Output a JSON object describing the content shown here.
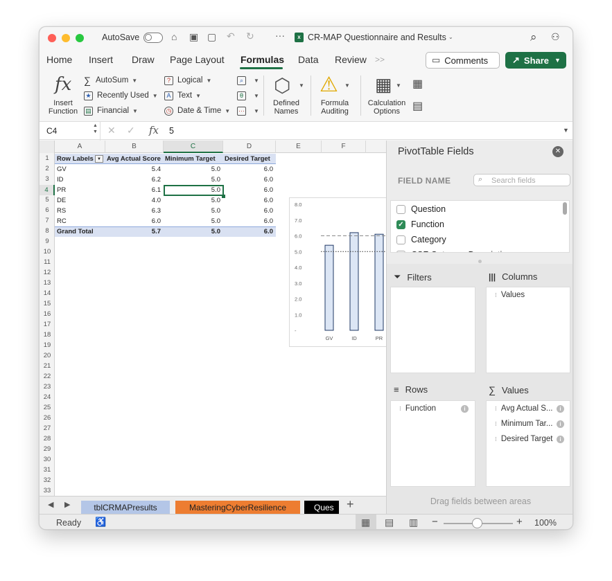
{
  "titlebar": {
    "autosave_label": "AutoSave",
    "title": "CR-MAP Questionnaire and Results"
  },
  "tabs": [
    "Home",
    "Insert",
    "Draw",
    "Page Layout",
    "Formulas",
    "Data",
    "Review"
  ],
  "active_tab": "Formulas",
  "comments_label": "Comments",
  "share_label": "Share",
  "ribbon": {
    "insert_function": "Insert Function",
    "autosum": "AutoSum",
    "recently_used": "Recently Used",
    "financial": "Financial",
    "logical": "Logical",
    "text": "Text",
    "date_time": "Date & Time",
    "defined_names": "Defined Names",
    "formula_auditing": "Formula Auditing",
    "calc_options": "Calculation Options"
  },
  "formula_bar": {
    "cell_ref": "C4",
    "fx": "fx",
    "value": "5"
  },
  "columns": [
    "A",
    "B",
    "C",
    "D",
    "E",
    "F"
  ],
  "rows": [
    "1",
    "2",
    "3",
    "4",
    "5",
    "6",
    "7",
    "8",
    "9",
    "10",
    "11",
    "12",
    "13",
    "14",
    "15",
    "16",
    "17",
    "18",
    "19",
    "20",
    "21",
    "22",
    "23",
    "24",
    "25",
    "26",
    "27",
    "28",
    "29",
    "30",
    "31",
    "32",
    "33"
  ],
  "pivot": {
    "headers": [
      "Row Labels",
      "Avg Actual Score",
      "Minimum Target",
      "Desired Target"
    ],
    "rows": [
      {
        "label": "GV",
        "avg": "5.4",
        "min": "5.0",
        "des": "6.0"
      },
      {
        "label": "ID",
        "avg": "6.2",
        "min": "5.0",
        "des": "6.0"
      },
      {
        "label": "PR",
        "avg": "6.1",
        "min": "5.0",
        "des": "6.0"
      },
      {
        "label": "DE",
        "avg": "4.0",
        "min": "5.0",
        "des": "6.0"
      },
      {
        "label": "RS",
        "avg": "6.3",
        "min": "5.0",
        "des": "6.0"
      },
      {
        "label": "RC",
        "avg": "6.0",
        "min": "5.0",
        "des": "6.0"
      }
    ],
    "total": {
      "label": "Grand Total",
      "avg": "5.7",
      "min": "5.0",
      "des": "6.0"
    }
  },
  "chart_data": {
    "type": "bar",
    "categories": [
      "GV",
      "ID",
      "PR"
    ],
    "series": [
      {
        "name": "Avg Actual Score",
        "values": [
          5.4,
          6.2,
          6.1
        ]
      },
      {
        "name": "Minimum Target",
        "values": [
          5.0,
          5.0,
          5.0
        ]
      },
      {
        "name": "Desired Target",
        "values": [
          6.0,
          6.0,
          6.0
        ]
      }
    ],
    "ylim": [
      0,
      8
    ],
    "yticks": [
      "8.0",
      "7.0",
      "6.0",
      "5.0",
      "4.0",
      "3.0",
      "2.0",
      "1.0",
      "-"
    ],
    "ytick_values": [
      8,
      7,
      6,
      5,
      4,
      3,
      2,
      1,
      0
    ],
    "bar_fill": "#dce6f5",
    "bar_stroke": "#1f3864"
  },
  "pivot_panel": {
    "title": "PivotTable Fields",
    "field_name_label": "FIELD NAME",
    "search_placeholder": "Search fields",
    "fields": [
      {
        "label": "Question",
        "checked": false
      },
      {
        "label": "Function",
        "checked": true
      },
      {
        "label": "Category",
        "checked": false
      },
      {
        "label": "CSF Outcome Description",
        "checked": false
      }
    ],
    "filters_label": "Filters",
    "columns_label": "Columns",
    "rows_label": "Rows",
    "values_label": "Values",
    "columns_items": [
      "Values"
    ],
    "rows_items": [
      "Function"
    ],
    "values_items": [
      "Avg Actual S...",
      "Minimum Tar...",
      "Desired Target"
    ],
    "drag_hint": "Drag fields between areas"
  },
  "sheet_tabs": [
    "tblCRMAPresults",
    "MasteringCyberResilience",
    "Ques"
  ],
  "status": {
    "ready": "Ready",
    "zoom": "100%"
  }
}
